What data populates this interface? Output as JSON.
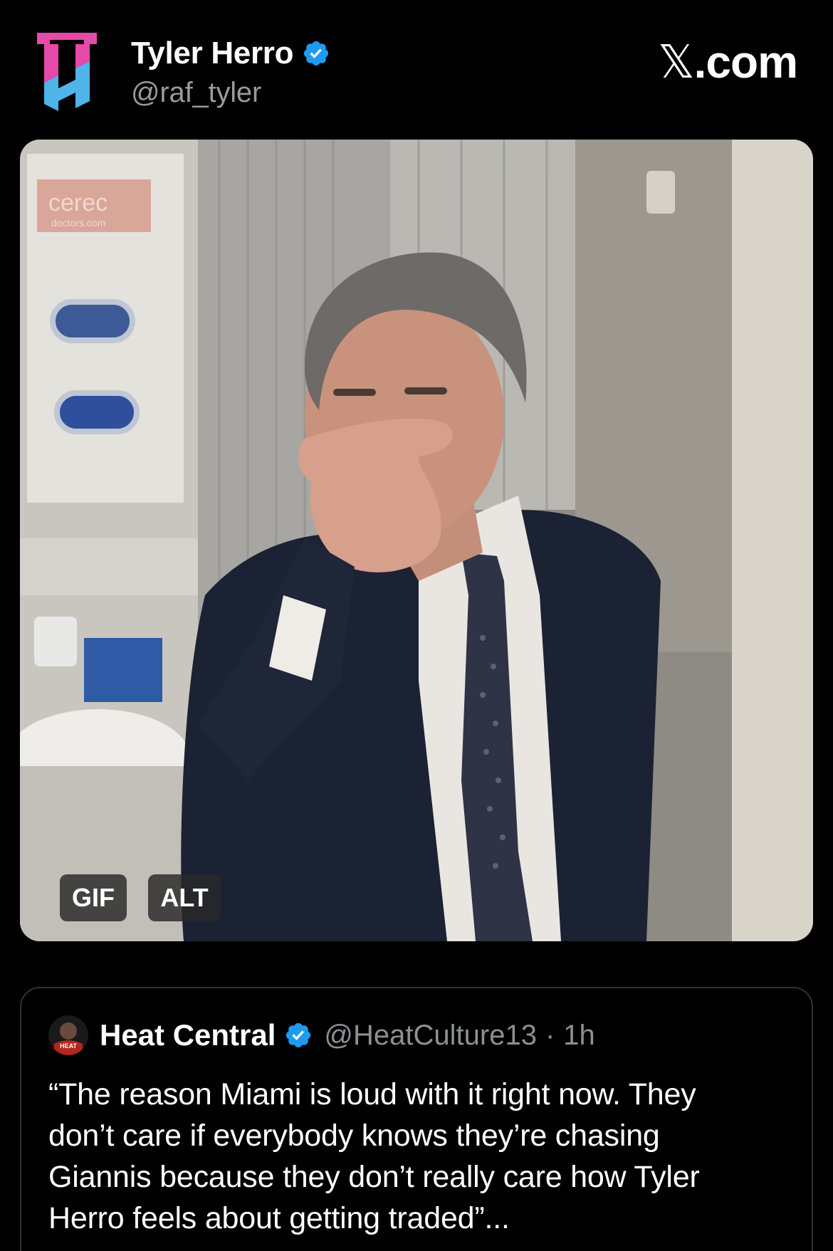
{
  "header": {
    "author_name": "Tyler Herro",
    "author_handle": "@raf_tyler",
    "site_label_x": "𝕏",
    "site_label_rest": ".com",
    "logo_icon": "th-monogram-logo",
    "verified_icon": "verified-badge-icon"
  },
  "media": {
    "poster_text": "cerec",
    "poster_subtext": "doctors.com",
    "gif_badge": "GIF",
    "alt_badge": "ALT"
  },
  "quote": {
    "name": "Heat Central",
    "handle": "@HeatCulture13",
    "separator": "·",
    "time": "1h",
    "text": "“The reason Miami is loud with it right now. They don’t care if everybody knows they’re chasing Giannis because they don’t really care how Tyler Herro feels about getting traded”...",
    "avatar_text": "HEAT CENTRAL"
  },
  "colors": {
    "background": "#000000",
    "verified": "#1d9bf0",
    "secondary_text": "#8b9095",
    "logo_pink": "#e64aa8",
    "logo_blue": "#4fb5e8"
  }
}
